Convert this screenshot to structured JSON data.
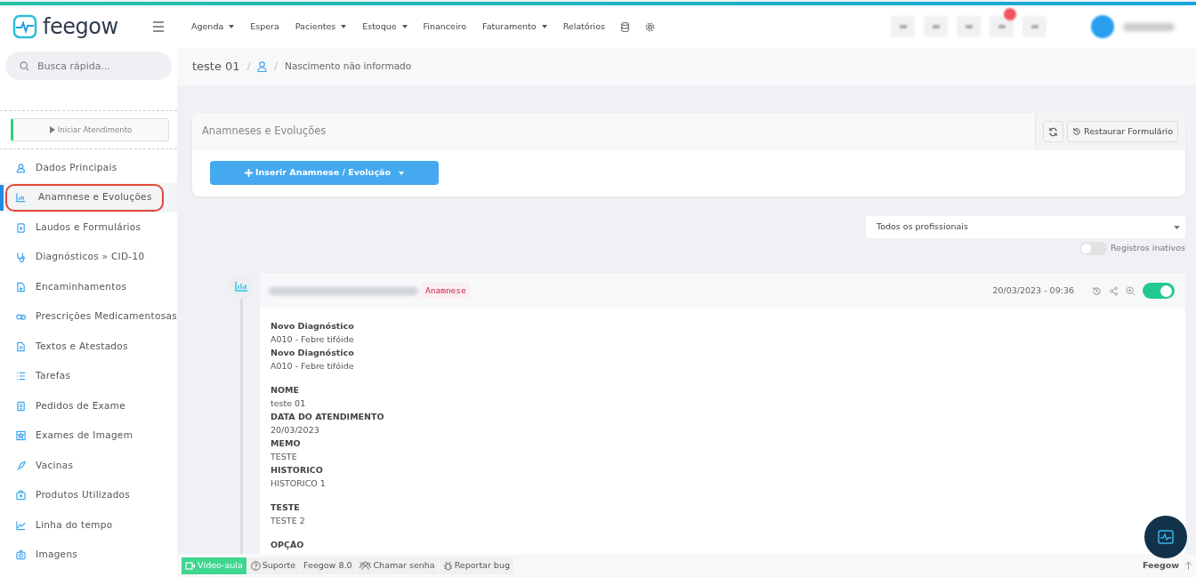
{
  "logo": {
    "text": "feegow"
  },
  "nav": [
    {
      "label": "Agenda",
      "dropdown": true
    },
    {
      "label": "Espera",
      "dropdown": false
    },
    {
      "label": "Pacientes",
      "dropdown": true
    },
    {
      "label": "Estoque",
      "dropdown": true
    },
    {
      "label": "Financeiro",
      "dropdown": false
    },
    {
      "label": "Faturamento",
      "dropdown": true
    },
    {
      "label": "Relatórios",
      "dropdown": false
    }
  ],
  "search": {
    "placeholder": "Busca rápida..."
  },
  "start_button": {
    "label": "Iniciar Atendimento"
  },
  "sidebar": {
    "items": [
      {
        "label": "Dados Principais",
        "selected": false
      },
      {
        "label": "Anamnese e Evoluções",
        "selected": true
      },
      {
        "label": "Laudos e Formulários",
        "selected": false
      },
      {
        "label": "Diagnósticos » CID-10",
        "selected": false
      },
      {
        "label": "Encaminhamentos",
        "selected": false
      },
      {
        "label": "Prescrições Medicamentosas",
        "selected": false
      },
      {
        "label": "Textos e Atestados",
        "selected": false
      },
      {
        "label": "Tarefas",
        "selected": false
      },
      {
        "label": "Pedidos de Exame",
        "selected": false
      },
      {
        "label": "Exames de Imagem",
        "selected": false
      },
      {
        "label": "Vacinas",
        "selected": false
      },
      {
        "label": "Produtos Utilizados",
        "selected": false
      },
      {
        "label": "Linha do tempo",
        "selected": false
      },
      {
        "label": "Imagens",
        "selected": false
      }
    ]
  },
  "breadcrumb": {
    "patient": "teste 01",
    "separators": [
      "/",
      "/"
    ],
    "birth": "Nascimento não informado"
  },
  "card": {
    "title": "Anamneses e Evoluções",
    "restore_button": "Restaurar Formulário",
    "insert_button": "Inserir Anamnese / Evolução"
  },
  "filter": {
    "value": "Todos os profissionais"
  },
  "inactive_toggle": {
    "label": "Registros inativos",
    "on": false
  },
  "record": {
    "badge": "Anamnese",
    "datetime": "20/03/2023 - 09:36",
    "active": true,
    "groups": [
      [
        {
          "label": "Novo Diagnóstico",
          "value": "A010 - Febre tifóide"
        },
        {
          "label": "Novo Diagnóstico",
          "value": "A010 - Febre tifóide"
        }
      ],
      [
        {
          "label": "NOME",
          "value": "teste 01"
        },
        {
          "label": "DATA DO ATENDIMENTO",
          "value": "20/03/2023"
        },
        {
          "label": "MEMO",
          "value": "TESTE"
        },
        {
          "label": "HISTORICO",
          "value": "HISTORICO 1"
        }
      ],
      [
        {
          "label": "TESTE",
          "value": "TESTE 2"
        }
      ],
      [
        {
          "label": "OPÇÃO"
        }
      ]
    ]
  },
  "footer": {
    "buttons": [
      {
        "label": "Vídeo-aula",
        "kind": "video"
      },
      {
        "label": "Suporte",
        "kind": "help"
      },
      {
        "label": "Feegow 8.0",
        "kind": "plain"
      },
      {
        "label": "Chamar senha",
        "kind": "people"
      },
      {
        "label": "Reportar bug",
        "kind": "bug"
      }
    ],
    "brand": "Feegow"
  }
}
